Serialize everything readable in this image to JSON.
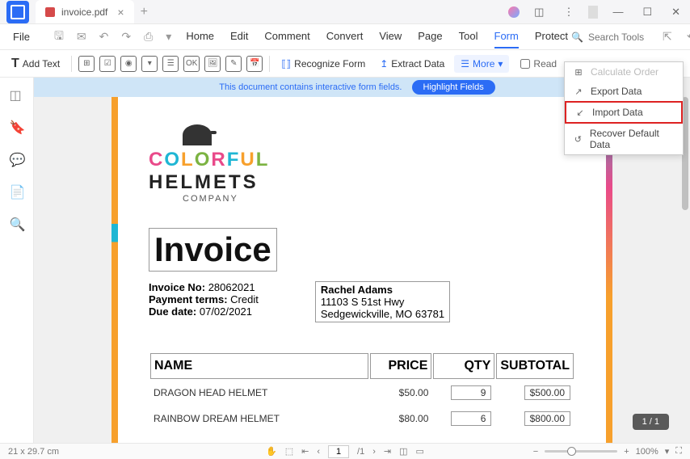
{
  "tab": {
    "title": "invoice.pdf"
  },
  "menubar": {
    "file": "File",
    "tabs": [
      "Home",
      "Edit",
      "Comment",
      "Convert",
      "View",
      "Page",
      "Tool",
      "Form",
      "Protect"
    ],
    "active": "Form",
    "search_placeholder": "Search Tools"
  },
  "toolbar": {
    "add_text": "Add Text",
    "recognize": "Recognize Form",
    "extract": "Extract Data",
    "more": "More",
    "read": "Read"
  },
  "banner": {
    "msg": "This document contains interactive form fields.",
    "btn": "Highlight Fields"
  },
  "dropdown": {
    "items": [
      {
        "label": "Calculate Order",
        "icon": "calc",
        "disabled": true
      },
      {
        "label": "Export Data",
        "icon": "export"
      },
      {
        "label": "Import Data",
        "icon": "import",
        "highlighted": true
      },
      {
        "label": "Recover Default Data",
        "icon": "recover"
      }
    ]
  },
  "logo": {
    "line1": "COLORFUL",
    "line2": "HELMETS",
    "sub": "COMPANY"
  },
  "invoice": {
    "title": "Invoice",
    "no_label": "Invoice No:",
    "no": "28062021",
    "terms_label": "Payment terms:",
    "terms": "Credit",
    "due_label": "Due date:",
    "due": "07/02/2021",
    "customer": {
      "name": "Rachel Adams",
      "addr1": "11103 S 51st Hwy",
      "addr2": "Sedgewickville, MO 63781"
    },
    "headers": [
      "NAME",
      "PRICE",
      "QTY",
      "SUBTOTAL"
    ],
    "rows": [
      {
        "name": "DRAGON HEAD HELMET",
        "price": "$50.00",
        "qty": "9",
        "subtotal": "$500.00"
      },
      {
        "name": "RAINBOW DREAM HELMET",
        "price": "$80.00",
        "qty": "6",
        "subtotal": "$800.00"
      }
    ]
  },
  "status": {
    "dims": "21 x 29.7 cm",
    "page_current": "1",
    "page_total": "/1",
    "zoom": "100%",
    "page_indicator": "1 / 1"
  }
}
